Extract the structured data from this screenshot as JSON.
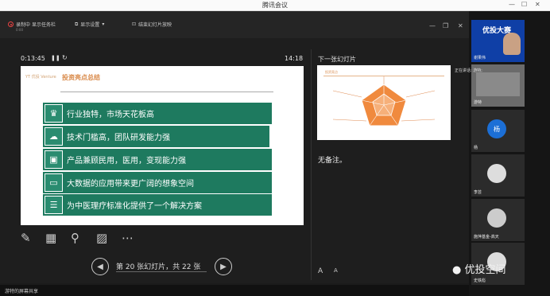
{
  "window": {
    "title": "腾讯会议"
  },
  "toolbar": {
    "recording_label": "录制中",
    "recording_time": "0:00",
    "show_taskbar": "显示任务栏",
    "display_settings": "显示设置",
    "end_slideshow": "结束幻灯片放映"
  },
  "presenter": {
    "elapsed": "0:13:45",
    "clock": "14:18",
    "next_label": "下一张幻灯片",
    "notes": "无备注。",
    "counter": "第 20 张幻灯片，共 22 张",
    "zoom_in": "A",
    "zoom_out": "A"
  },
  "slide": {
    "logo": "YT 优投 Venture",
    "title": "投资亮点总结",
    "rows": [
      {
        "icon": "trophy-icon",
        "text": "行业独特，市场天花板高"
      },
      {
        "icon": "handshake-icon",
        "text": "技术门槛高，团队研发能力强"
      },
      {
        "icon": "monitor-icon",
        "text": "产品兼顾民用，医用，变现能力强"
      },
      {
        "icon": "folder-icon",
        "text": "大数据的应用带来更广阔的想象空间"
      },
      {
        "icon": "database-icon",
        "text": "为中医理疗标准化提供了一个解决方案"
      }
    ]
  },
  "next_slide": {
    "mini_title": "投资亮点"
  },
  "participants": [
    {
      "name": "谢果伟",
      "banner": "优投大赛"
    },
    {
      "name": "游特"
    },
    {
      "name": "杨",
      "avatar_letter": "杨",
      "avatar_color": "#1c6fd6"
    },
    {
      "name": "李芸"
    },
    {
      "name": "施萍基金-高天"
    },
    {
      "name": "史铁彪"
    }
  ],
  "speaking": {
    "label": "正在讲话: 游特;"
  },
  "status": {
    "text": "游特的屏幕共享"
  },
  "watermark": {
    "text": "优投空间"
  }
}
